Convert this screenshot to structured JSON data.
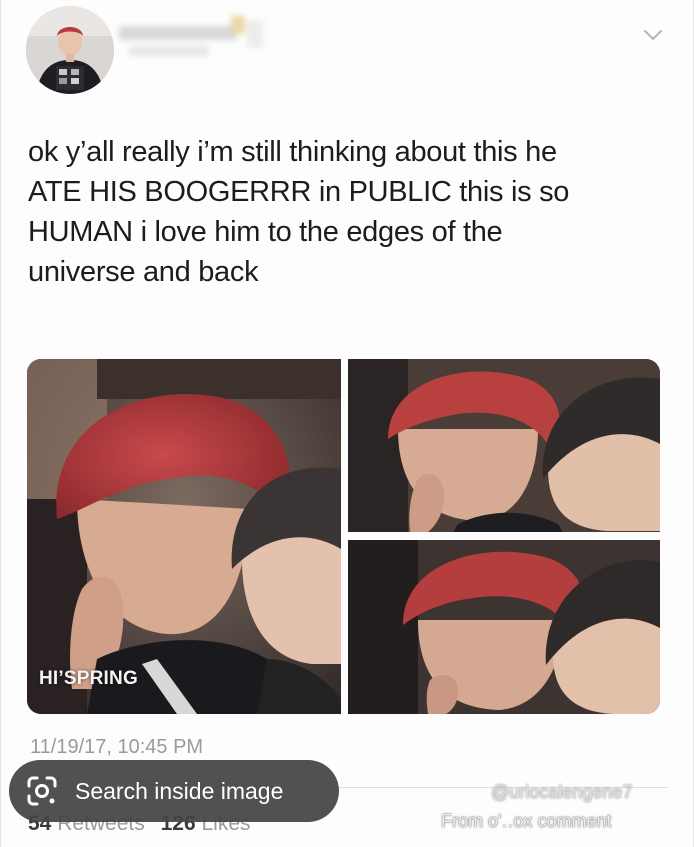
{
  "tweet": {
    "text_lines": [
      "ok y’all really i’m still thinking about this he",
      "ATE HIS BOOGERRR in PUBLIC this is so",
      "HUMAN i love him to the edges of the",
      "universe and back"
    ],
    "watermark": "HI’SPRING",
    "timestamp": "11/19/17, 10:45 PM",
    "retweets_count": "54",
    "retweets_label": "Retweets",
    "likes_count": "126",
    "likes_label": "Likes"
  },
  "icons": {
    "menu": "chevron-down-icon",
    "lens": "google-lens-icon"
  },
  "overlay": {
    "search_label": "Search inside image"
  },
  "credits": {
    "line1": "@uriocalengene7",
    "line2": "From o'‥ox comment"
  },
  "colors": {
    "text": "#1c1c1c",
    "muted": "#9a9a9a",
    "pill": "#444444",
    "hair_red": "#b23a3c"
  }
}
